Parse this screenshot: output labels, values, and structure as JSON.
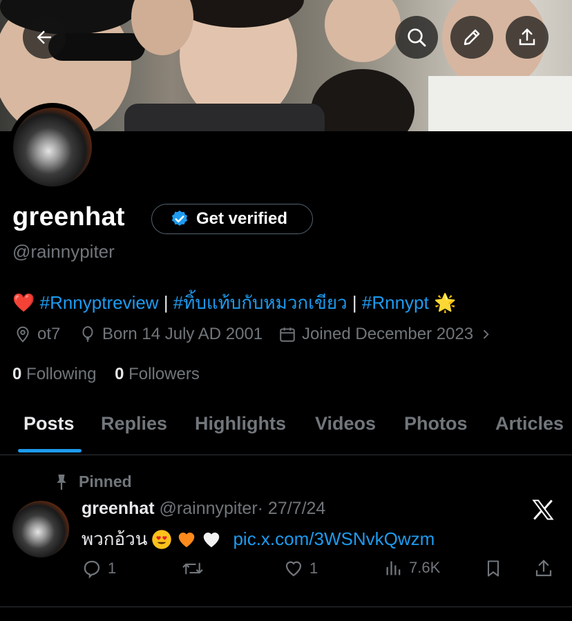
{
  "profile": {
    "name": "greenhat",
    "handle": "@rainnypiter",
    "get_verified_label": "Get verified",
    "bio": {
      "emoji_start": "❤️",
      "tag1": "#Rnnyptreview",
      "sep1": " | ",
      "tag2": "#ทิ้บแท้บกับหมวกเขียว",
      "sep2": " | ",
      "tag3": "#Rnnypt",
      "emoji_end": "🌟"
    },
    "location": "ot7",
    "birthday": "Born 14 July AD 2001",
    "joined": "Joined December 2023",
    "following_count": "0",
    "following_label": "Following",
    "followers_count": "0",
    "followers_label": "Followers"
  },
  "tabs": [
    "Posts",
    "Replies",
    "Highlights",
    "Videos",
    "Photos",
    "Articles"
  ],
  "post": {
    "pinned_label": "Pinned",
    "author_name": "greenhat",
    "author_handle": "@rainnypiter",
    "date": "· 27/7/24",
    "text": "พวกอ้วน",
    "link": "pic.x.com/3WSNvkQwzm",
    "replies": "1",
    "likes": "1",
    "views": "7.6K"
  },
  "icons": {
    "back": "arrow-left-icon",
    "search": "search-icon",
    "edit": "pencil-icon",
    "share": "share-icon",
    "verified": "verified-badge-icon",
    "location": "location-pin-icon",
    "birthday": "balloon-icon",
    "calendar": "calendar-icon",
    "x_logo": "x-logo-icon"
  },
  "colors": {
    "accent": "#1d9bf0",
    "muted": "#71767b",
    "text": "#e7e9ea",
    "background": "#000000"
  }
}
